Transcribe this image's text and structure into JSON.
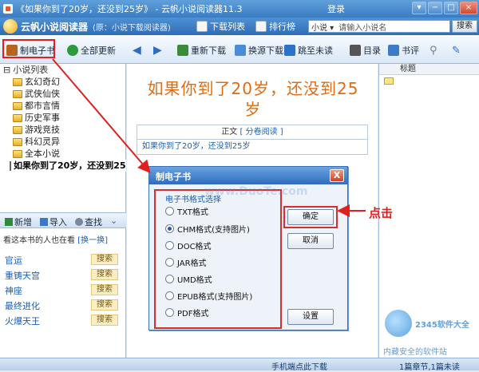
{
  "window": {
    "title": "《如果你到了20岁，还没到25岁》 - 云帆小说阅读器11.3",
    "login": "登录",
    "buttons": [
      "▾",
      "−",
      "□",
      "×"
    ]
  },
  "brandbar": {
    "name": "云帆小说阅读器",
    "subtitle": "(原：小说下载阅读器)",
    "tabs": [
      "下载列表",
      "排行榜"
    ],
    "search_category": "小说 ▾",
    "search_placeholder": "请输入小说名",
    "search_button": "搜索"
  },
  "toolbar": {
    "make_ebook": "制电子书",
    "update_all": "全部更新",
    "redownload": "重新下载",
    "change_source": "换源下载",
    "jump_unread": "跳至未读",
    "catalog": "目录",
    "review": "书评"
  },
  "tree": {
    "root": "小说列表",
    "categories": [
      "玄幻奇幻",
      "武侠仙侠",
      "都市言情",
      "历史军事",
      "游戏竞技",
      "科幻灵异",
      "全本小说"
    ],
    "selected_book": "如果你到了20岁，还没到25岁"
  },
  "panel_actions": {
    "add": "新增",
    "import": "导入",
    "find": "查找"
  },
  "readers": {
    "title": "看这本书的人也在看",
    "refresh": "[换一换]",
    "items": [
      "官运",
      "重铸天宫",
      "神座",
      "最终进化",
      "火爆天王"
    ],
    "chip": "搜索"
  },
  "main": {
    "title_line1": "如果你到了20岁，还没到25",
    "title_line2": "岁",
    "toc_label": "正文",
    "toc_link": "[ 分卷阅读 ]",
    "chapter": "如果你到了20岁，还没到25岁"
  },
  "right_panel": {
    "header": "标题"
  },
  "dialog": {
    "title": "制电子书",
    "close": "X",
    "group_label": "电子书格式选择",
    "options": [
      "TXT格式",
      "CHM格式(支持图片)",
      "DOC格式",
      "JAR格式",
      "UMD格式",
      "EPUB格式(支持图片)",
      "PDF格式"
    ],
    "selected_index": 1,
    "ok": "确定",
    "cancel": "取消",
    "settings": "设置"
  },
  "annotation": {
    "click": "点击"
  },
  "watermarks": {
    "center": "www.DuoTe.com",
    "brand": "2345软件大全",
    "sub": "内藏安全的软件站"
  },
  "status": {
    "mobile": "手机端点此下载",
    "chapters": "1篇章节,1篇未读"
  },
  "colors": {
    "titlebar": "#3b7cc2",
    "accent_orange": "#e06b10",
    "highlight_red": "#d23030",
    "link_blue": "#1a5fb4"
  }
}
